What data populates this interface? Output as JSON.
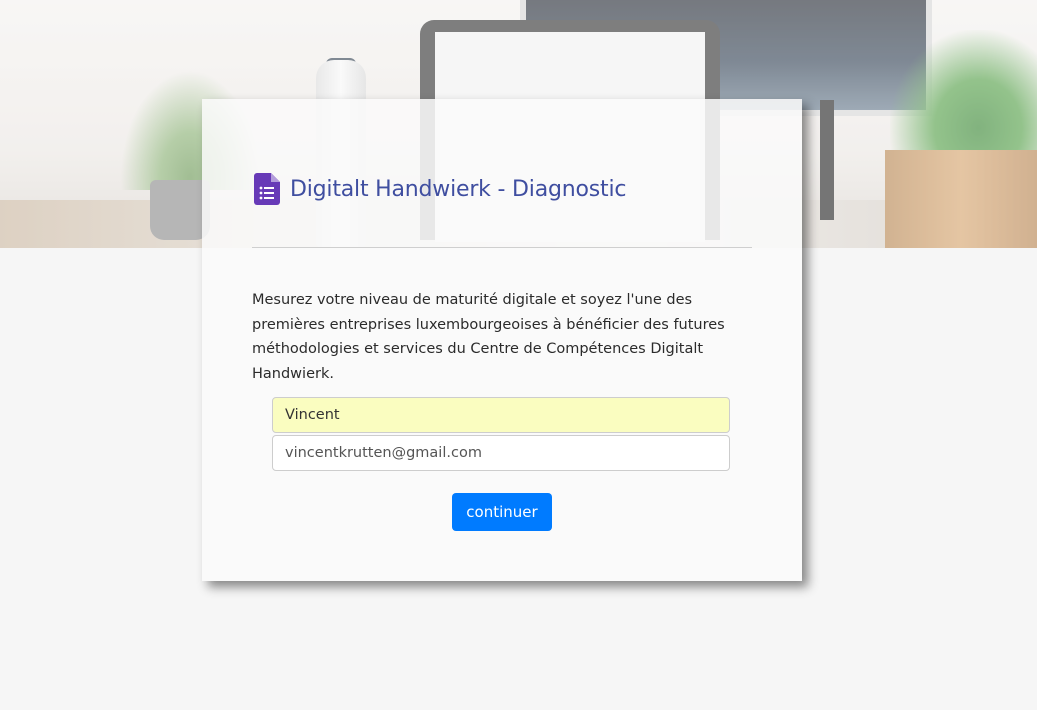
{
  "header": {
    "title": "Digitalt Handwierk - Diagnostic",
    "icon": "google-forms-icon",
    "icon_color": "#673ab7"
  },
  "intro": {
    "text": "Mesurez votre niveau de maturité digitale et soyez l'une des premières entreprises luxembourgeoises à bénéficier des futures méthodologies et services du Centre de Compétences Digitalt Handwierk."
  },
  "form": {
    "name_value": "Vincent",
    "email_value": "vincentkrutten@gmail.com",
    "submit_label": "continuer",
    "accent_color": "#007bff"
  }
}
